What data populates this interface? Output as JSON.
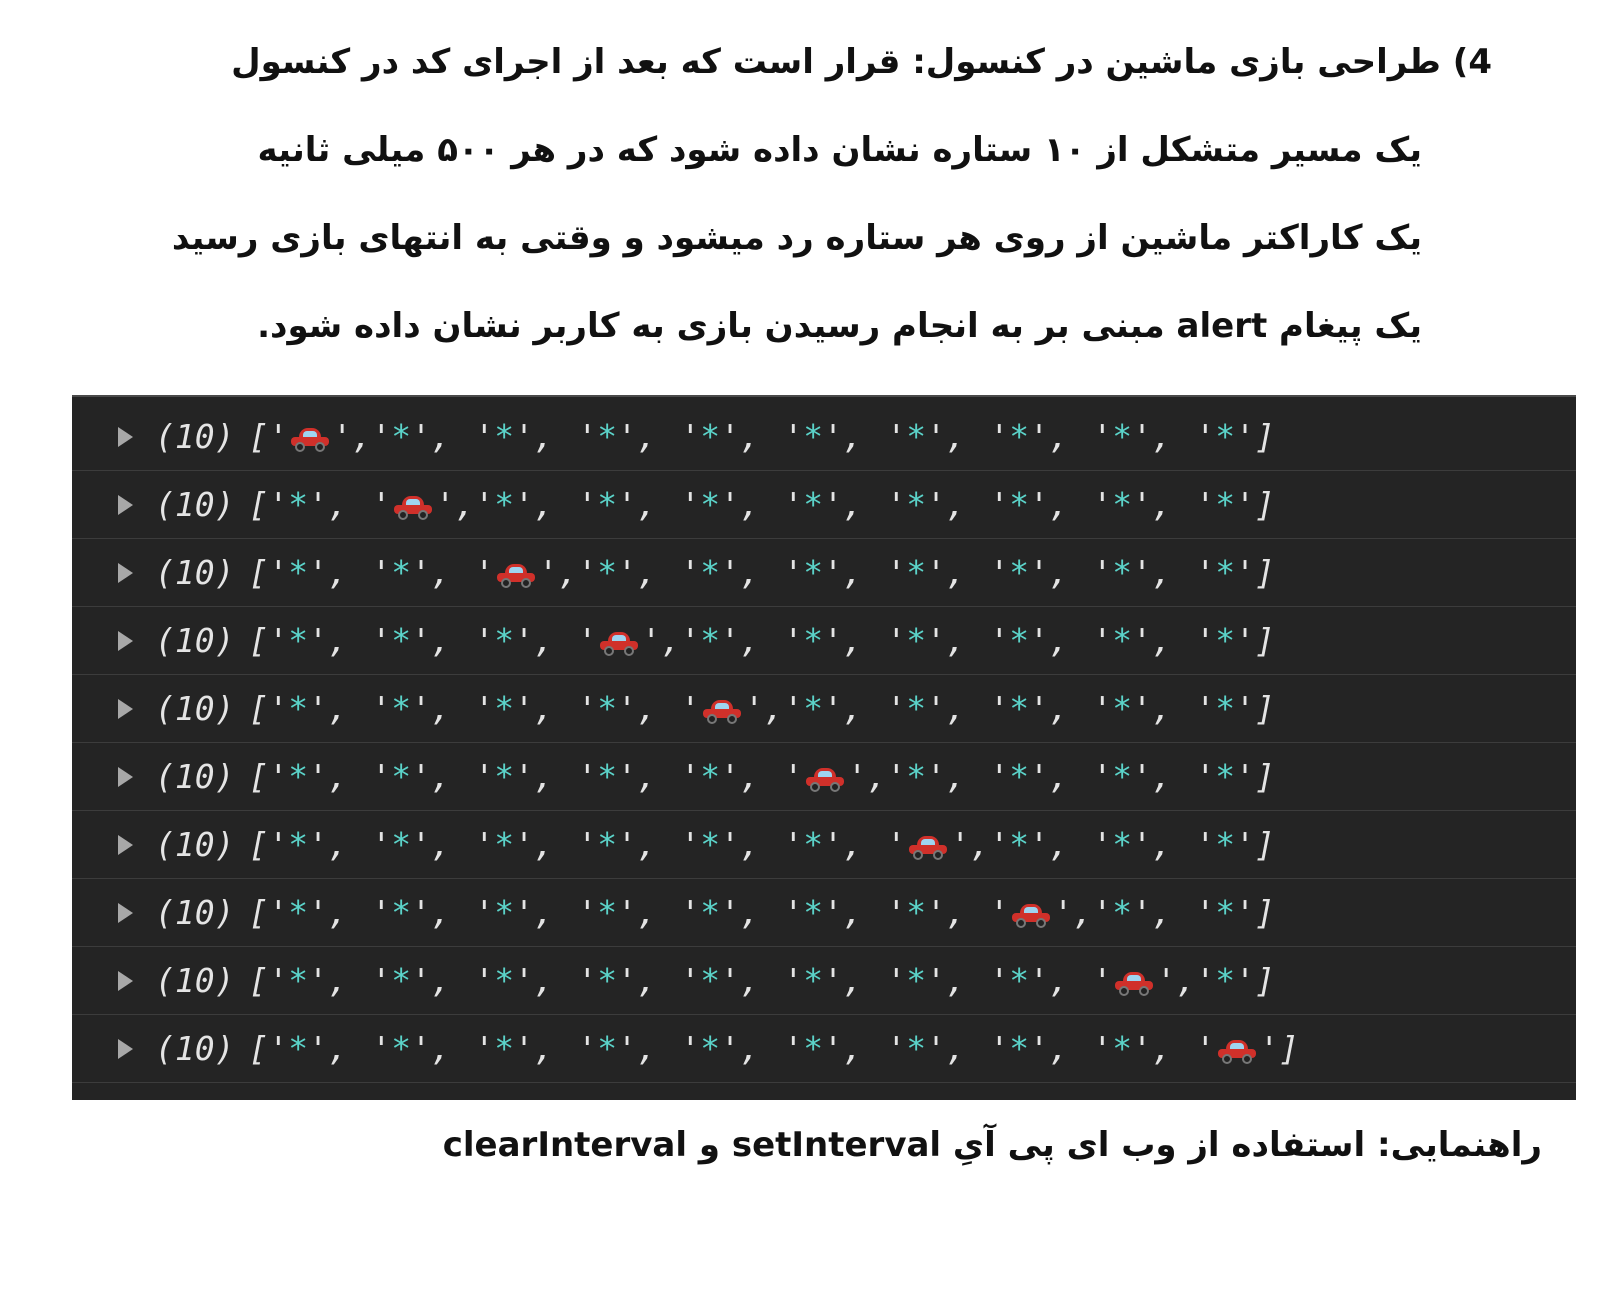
{
  "task": {
    "lines": [
      "4) طراحی بازی ماشین در کنسول: قرار است  که بعد از اجرای کد در کنسول",
      "یک مسیر متشکل از ۱۰ ستاره نشان داده شود که در هر ۵۰۰ میلی ثانیه",
      "یک کاراکتر ماشین از روی هر ستاره رد میشود و وقتی به انتهای بازی رسید",
      "یک پیغام alert مبنی بر به انجام رسیدن بازی به کاربر نشان داده شود."
    ]
  },
  "console": {
    "count_label": "(10)",
    "star_symbol": "*",
    "car_icon": "red-car-icon",
    "car_positions": [
      0,
      1,
      2,
      3,
      4,
      5,
      6,
      7,
      8,
      9
    ],
    "star_color": "#5bd3c9",
    "background": "#242424"
  },
  "hint": {
    "text": "راهنمایی: استفاده از وب ای پی آیِ setInterval و  clearInterval"
  }
}
